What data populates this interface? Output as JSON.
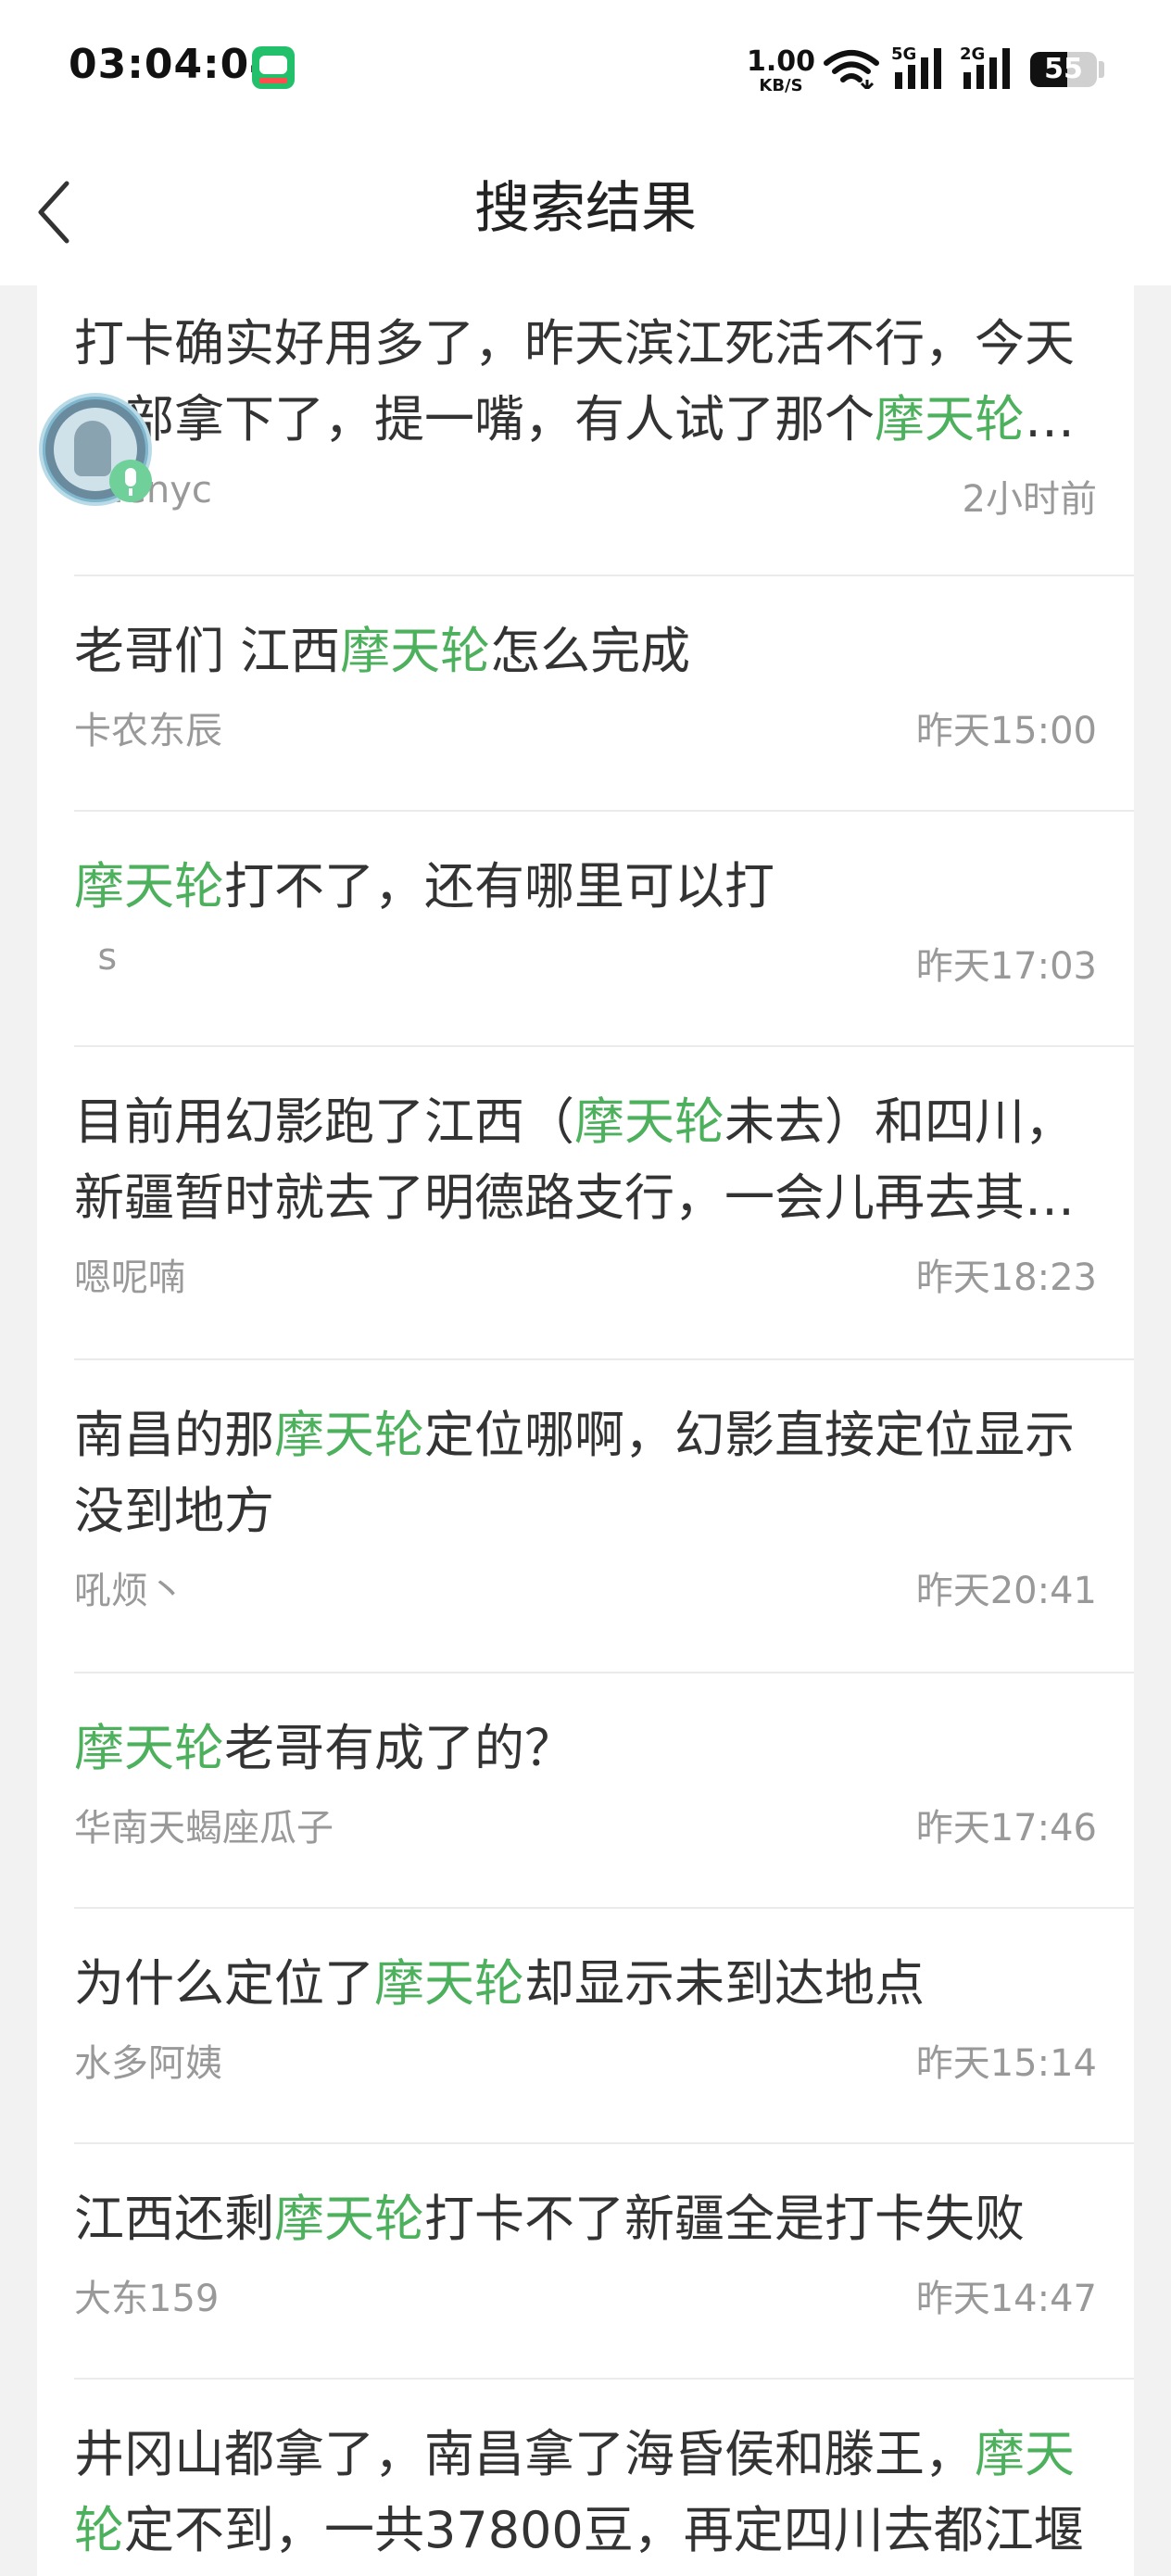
{
  "status_bar": {
    "time": "03:04:04",
    "net_speed_value": "1.00",
    "net_speed_unit": "KB/S",
    "signal1_label": "5G",
    "signal2_label": "2G",
    "battery": "55",
    "battery_level": 0.55
  },
  "nav": {
    "title": "搜索结果",
    "back_icon": "chevron-left-icon"
  },
  "highlight_color": "#4cb05c",
  "results": [
    {
      "title_parts": [
        {
          "text": "打卡确实好用多了，昨天滨江死活不行，今天全部拿下了，提一嘴，有人试了那个",
          "hl": false
        },
        {
          "text": "摩天轮怎么样",
          "hl": true
        }
      ],
      "author": "Chenyc",
      "time": "2小时前"
    },
    {
      "title_parts": [
        {
          "text": "老哥们 江西",
          "hl": false
        },
        {
          "text": "摩天轮",
          "hl": true
        },
        {
          "text": "怎么完成",
          "hl": false
        }
      ],
      "author": "卡农东辰",
      "time": "昨天15:00"
    },
    {
      "title_parts": [
        {
          "text": "摩天轮",
          "hl": true
        },
        {
          "text": "打不了，还有哪里可以打",
          "hl": false
        }
      ],
      "author": "  s",
      "time": "昨天17:03"
    },
    {
      "title_parts": [
        {
          "text": "目前用幻影跑了江西（",
          "hl": false
        },
        {
          "text": "摩天轮",
          "hl": true
        },
        {
          "text": "未去）和四川，新疆暂时就去了明德路支行，一会儿再去其他地方",
          "hl": false
        }
      ],
      "author": "嗯呢喃",
      "time": "昨天18:23"
    },
    {
      "title_parts": [
        {
          "text": "南昌的那",
          "hl": false
        },
        {
          "text": "摩天轮",
          "hl": true
        },
        {
          "text": "定位哪啊，幻影直接定位显示没到地方",
          "hl": false
        }
      ],
      "author": "吼烦丶",
      "time": "昨天20:41"
    },
    {
      "title_parts": [
        {
          "text": "摩天轮",
          "hl": true
        },
        {
          "text": "老哥有成了的？",
          "hl": false
        }
      ],
      "author": "华南天蝎座瓜子",
      "time": "昨天17:46"
    },
    {
      "title_parts": [
        {
          "text": "为什么定位了",
          "hl": false
        },
        {
          "text": "摩天轮",
          "hl": true
        },
        {
          "text": "却显示未到达地点",
          "hl": false
        }
      ],
      "author": "水多阿姨",
      "time": "昨天15:14"
    },
    {
      "title_parts": [
        {
          "text": "江西还剩",
          "hl": false
        },
        {
          "text": "摩天轮",
          "hl": true
        },
        {
          "text": "打卡不了新疆全是打卡失败",
          "hl": false
        }
      ],
      "author": "大东159",
      "time": "昨天14:47"
    },
    {
      "title_parts": [
        {
          "text": "井冈山都拿了，南昌拿了海昏侯和滕王，",
          "hl": false
        },
        {
          "text": "摩天轮",
          "hl": true
        },
        {
          "text": "定不到，一共37800豆，再定四川去都江堰",
          "hl": false
        }
      ],
      "author": "",
      "time": ""
    }
  ]
}
